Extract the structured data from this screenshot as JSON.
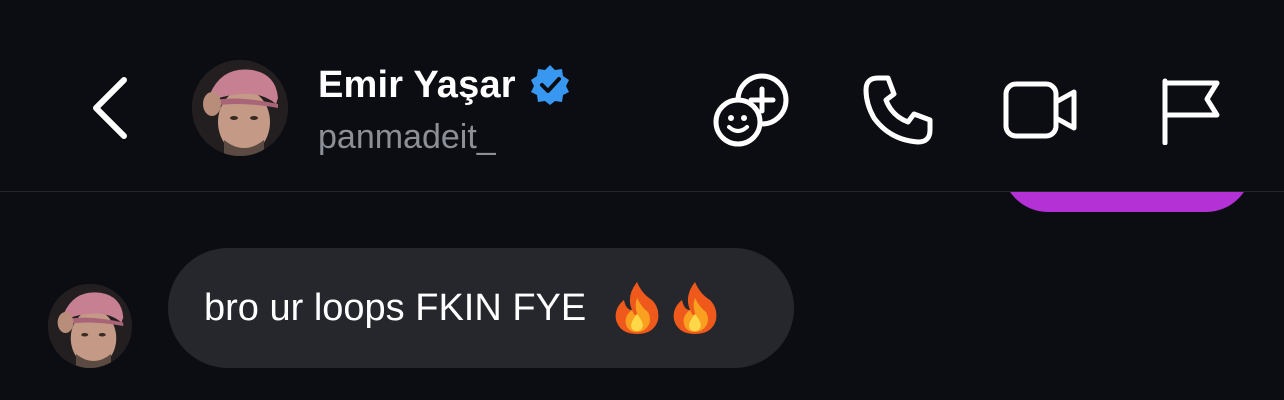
{
  "header": {
    "back_label": "",
    "display_name": "Emir Yaşar",
    "username": "panmadeit_",
    "verified": true,
    "verified_color": "#3897f0",
    "actions": [
      {
        "name": "add-participant-icon"
      },
      {
        "name": "phone-icon"
      },
      {
        "name": "video-call-icon"
      },
      {
        "name": "flag-icon"
      }
    ]
  },
  "conversation": {
    "outgoing_bubble_color": "#b431d6",
    "incoming_bubble_color": "#25272c",
    "messages": [
      {
        "direction": "incoming",
        "text": "bro ur loops FKIN FYE",
        "emoji": [
          "🔥",
          "🔥"
        ]
      }
    ]
  },
  "theme": {
    "background": "#0b0d12",
    "text_primary": "#ffffff",
    "text_secondary": "#8c8f96"
  }
}
